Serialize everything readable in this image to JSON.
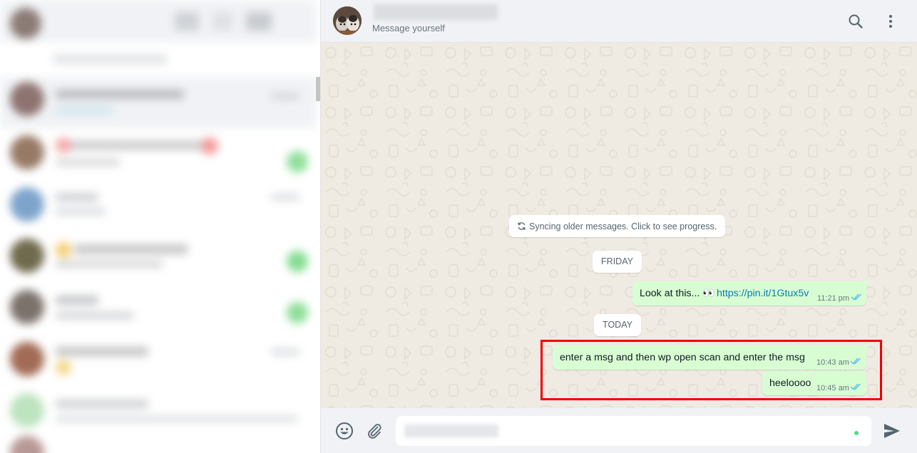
{
  "chat_header": {
    "subtitle": "Message yourself",
    "search_icon": "search-icon",
    "menu_icon": "kebab-menu-icon"
  },
  "system_notice": {
    "text": "Syncing older messages. Click to see progress.",
    "icon": "sync-icon"
  },
  "date_chips": {
    "friday": "FRIDAY",
    "today": "TODAY"
  },
  "messages": [
    {
      "text_before_link": "Look at this... 👀",
      "link": "https://pin.it/1Gtux5v",
      "time": "11:21 pm",
      "status": "read"
    },
    {
      "text": "enter a  msg and then wp open scan and  enter the msg",
      "time": "10:43 am",
      "status": "read"
    },
    {
      "text": "heeloooo",
      "time": "10:45 am",
      "status": "read"
    }
  ],
  "composer": {
    "emoji_icon": "emoji-icon",
    "attach_icon": "paperclip-icon",
    "send_icon": "send-icon"
  },
  "colors": {
    "outgoing_bubble": "#d9fdd3",
    "chat_background": "#efeae2",
    "header_background": "#f0f2f5",
    "read_ticks": "#53bdeb",
    "link": "#027eb5",
    "highlight_box": "#f00000"
  }
}
